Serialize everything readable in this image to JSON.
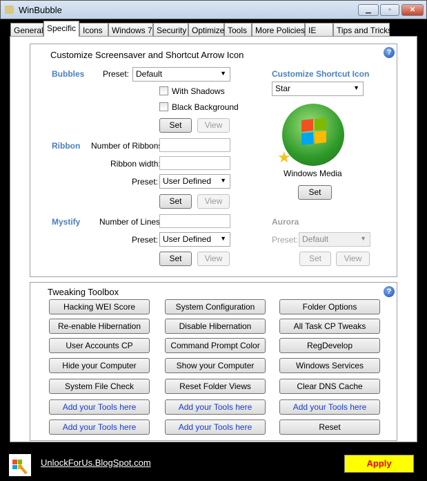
{
  "window": {
    "title": "WinBubble"
  },
  "tabs": [
    "General",
    "Specific",
    "Icons",
    "Windows 7",
    "Security",
    "Optimize",
    "Tools",
    "More Policies",
    "IE",
    "Tips and Tricks"
  ],
  "screensaver": {
    "title": "Customize Screensaver and Shortcut Arrow Icon",
    "bubbles": {
      "label": "Bubbles",
      "preset_label": "Preset:",
      "preset": "Default",
      "with_shadows": "With Shadows",
      "black_background": "Black Background",
      "set": "Set",
      "view": "View"
    },
    "ribbon": {
      "label": "Ribbon",
      "num_label": "Number of Ribbons:",
      "num_value": "",
      "width_label": "Ribbon width:",
      "width_value": "",
      "preset_label": "Preset:",
      "preset": "User Defined",
      "set": "Set",
      "view": "View"
    },
    "mystify": {
      "label": "Mystify",
      "lines_label": "Number of Lines:",
      "lines_value": "",
      "preset_label": "Preset:",
      "preset": "User Defined",
      "set": "Set",
      "view": "View"
    },
    "shortcut": {
      "label": "Customize Shortcut Icon",
      "selected": "Star",
      "preview_caption": "Windows Media",
      "set": "Set"
    },
    "aurora": {
      "label": "Aurora",
      "preset_label": "Preset:",
      "preset": "Default",
      "set": "Set",
      "view": "View"
    }
  },
  "toolbox": {
    "title": "Tweaking Toolbox",
    "buttons": [
      "Hacking WEI Score",
      "System Configuration",
      "Folder Options",
      "Re-enable Hibernation",
      "Disable Hibernation",
      "All Task CP Tweaks",
      "User Accounts CP",
      "Command Prompt Color",
      "RegDevelop",
      "Hide your Computer",
      "Show your Computer",
      "Windows Services",
      "System File Check",
      "Reset Folder Views",
      "Clear DNS Cache",
      "Add your Tools here",
      "Add your Tools here",
      "Add your Tools here",
      "Add your Tools here",
      "Add your Tools here",
      "Reset"
    ]
  },
  "footer": {
    "url": "UnlockForUs.BlogSpot.com",
    "apply": "Apply"
  }
}
